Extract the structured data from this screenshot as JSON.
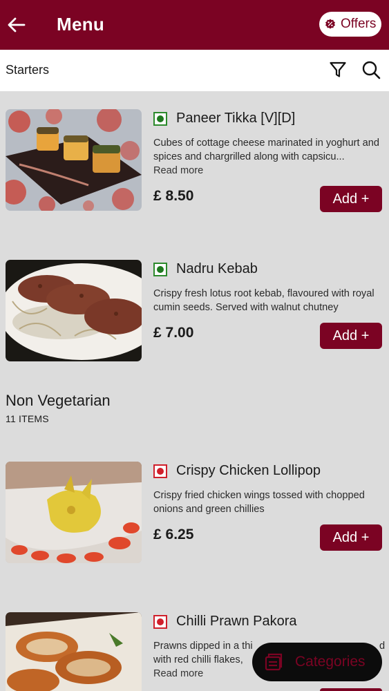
{
  "header": {
    "title": "Menu",
    "offers_label": "Offers"
  },
  "subheader": {
    "title": "Starters"
  },
  "items_starters": [
    {
      "name": "Paneer Tikka [V][D]",
      "description": "Cubes of cottage cheese marinated in yoghurt and spices and chargrilled along with capsicu...",
      "read_more": "Read more",
      "price": "£ 8.50",
      "add_label": "Add +",
      "type": "veg"
    },
    {
      "name": "Nadru Kebab",
      "description": "Crispy fresh lotus root kebab, flavoured with royal cumin seeds. Served with walnut chutney",
      "price": "£ 7.00",
      "add_label": "Add +",
      "type": "veg"
    }
  ],
  "section_non_veg": {
    "title": "Non Vegetarian",
    "count": "11 ITEMS"
  },
  "items_non_veg": [
    {
      "name": "Crispy Chicken Lollipop",
      "description": "Crispy fried chicken wings tossed with chopped onions and green chillies",
      "price": "£ 6.25",
      "add_label": "Add +",
      "type": "non-veg"
    },
    {
      "name": "Chilli Prawn Pakora",
      "description_line1": "Prawns dipped in a thi",
      "description_line1_end": "d",
      "description_line2": "with red chilli flakes,",
      "read_more": "Read more",
      "type": "non-veg"
    }
  ],
  "floating": {
    "categories_label": "Categories"
  },
  "colors": {
    "brand": "#7b0323",
    "background": "#dcdcdc",
    "veg": "#1f7a1f",
    "non_veg": "#d01f2b"
  },
  "icons": {
    "back": "arrow-left-icon",
    "offers": "discount-badge-icon",
    "filter": "filter-icon",
    "search": "search-icon",
    "categories": "menu-book-icon"
  }
}
